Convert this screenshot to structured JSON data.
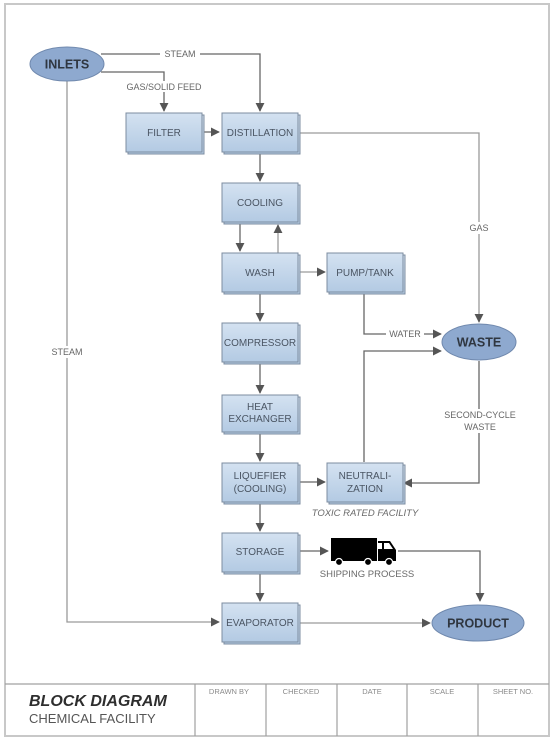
{
  "diagram": {
    "title_block": {
      "title": "BLOCK DIAGRAM",
      "subtitle": "CHEMICAL FACILITY",
      "fields": [
        {
          "label": "DRAWN BY",
          "value": ""
        },
        {
          "label": "CHECKED",
          "value": ""
        },
        {
          "label": "DATE",
          "value": ""
        },
        {
          "label": "SCALE",
          "value": ""
        },
        {
          "label": "SHEET NO.",
          "value": ""
        }
      ]
    },
    "terminals": {
      "inlets": "INLETS",
      "waste": "WASTE",
      "product": "PRODUCT"
    },
    "processes": {
      "filter": [
        "FILTER"
      ],
      "distillation": [
        "DISTILLATION"
      ],
      "cooling": [
        "COOLING"
      ],
      "wash": [
        "WASH"
      ],
      "pump_tank": [
        "PUMP/TANK"
      ],
      "compressor": [
        "COMPRESSOR"
      ],
      "heat_exchanger": [
        "HEAT",
        "EXCHANGER"
      ],
      "liquefier": [
        "LIQUEFIER",
        "(COOLING)"
      ],
      "neutralization": [
        "NEUTRALI-",
        "ZATION"
      ],
      "storage": [
        "STORAGE"
      ],
      "evaporator": [
        "EVAPORATOR"
      ]
    },
    "connector_labels": {
      "steam_top": "STEAM",
      "gas_solid_feed": "GAS/SOLID FEED",
      "gas": "GAS",
      "water": "WATER",
      "steam_left": "STEAM",
      "second_cycle": [
        "SECOND-CYCLE",
        "WASTE"
      ]
    },
    "annotations": {
      "toxic": "TOXIC RATED FACILITY",
      "shipping": "SHIPPING PROCESS"
    },
    "icons": {
      "shipping": "truck-icon"
    },
    "colors": {
      "box_fill_top": "#d2e0f0",
      "box_fill_bottom": "#b4cbe4",
      "ellipse_fill": "#8ea9cf",
      "connector": "#666666"
    }
  }
}
